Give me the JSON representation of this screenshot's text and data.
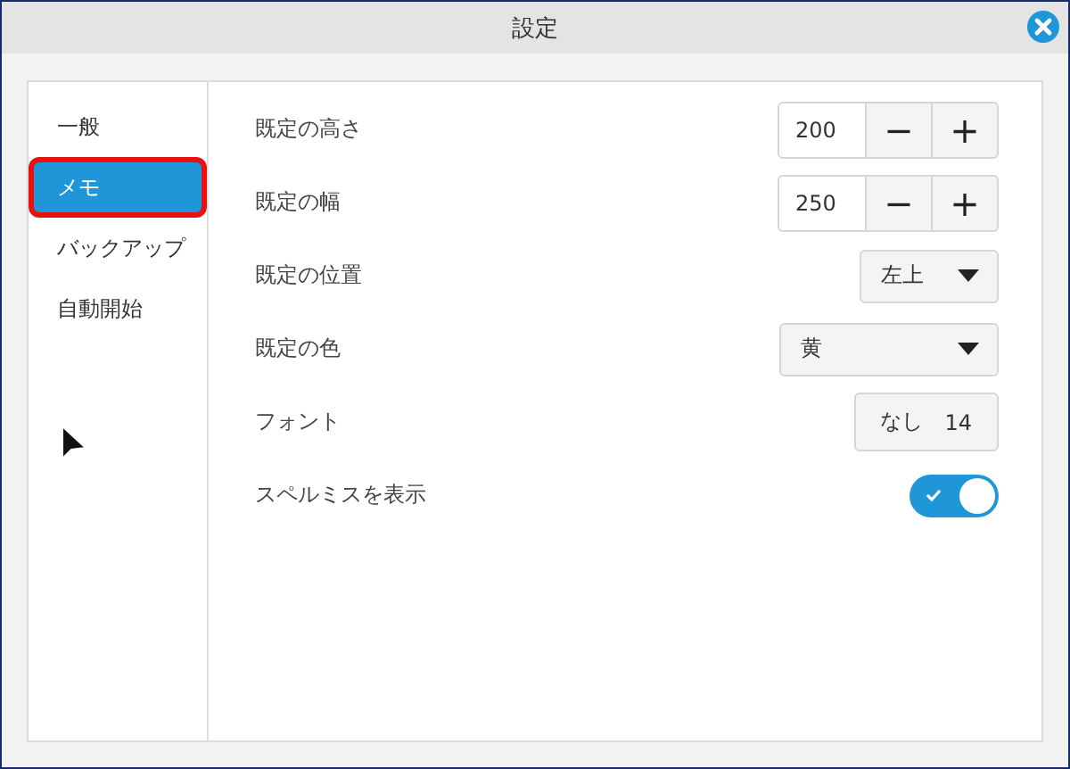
{
  "window": {
    "title": "設定"
  },
  "sidebar": {
    "items": [
      {
        "label": "一般",
        "selected": false,
        "annotated": false
      },
      {
        "label": "メモ",
        "selected": true,
        "annotated": true
      },
      {
        "label": "バックアップ",
        "selected": false,
        "annotated": false
      },
      {
        "label": "自動開始",
        "selected": false,
        "annotated": false
      }
    ]
  },
  "settings": [
    {
      "kind": "stepper",
      "label": "既定の高さ",
      "value": "200",
      "minus": "−",
      "plus": "+"
    },
    {
      "kind": "stepper",
      "label": "既定の幅",
      "value": "250",
      "minus": "−",
      "plus": "+"
    },
    {
      "kind": "dropdown",
      "label": "既定の位置",
      "value": "左上",
      "wide": false
    },
    {
      "kind": "dropdown",
      "label": "既定の色",
      "value": "黄",
      "wide": true
    },
    {
      "kind": "font",
      "label": "フォント",
      "font": "なし",
      "size": "14"
    },
    {
      "kind": "toggle",
      "label": "スペルミスを表示",
      "on": true
    }
  ]
}
